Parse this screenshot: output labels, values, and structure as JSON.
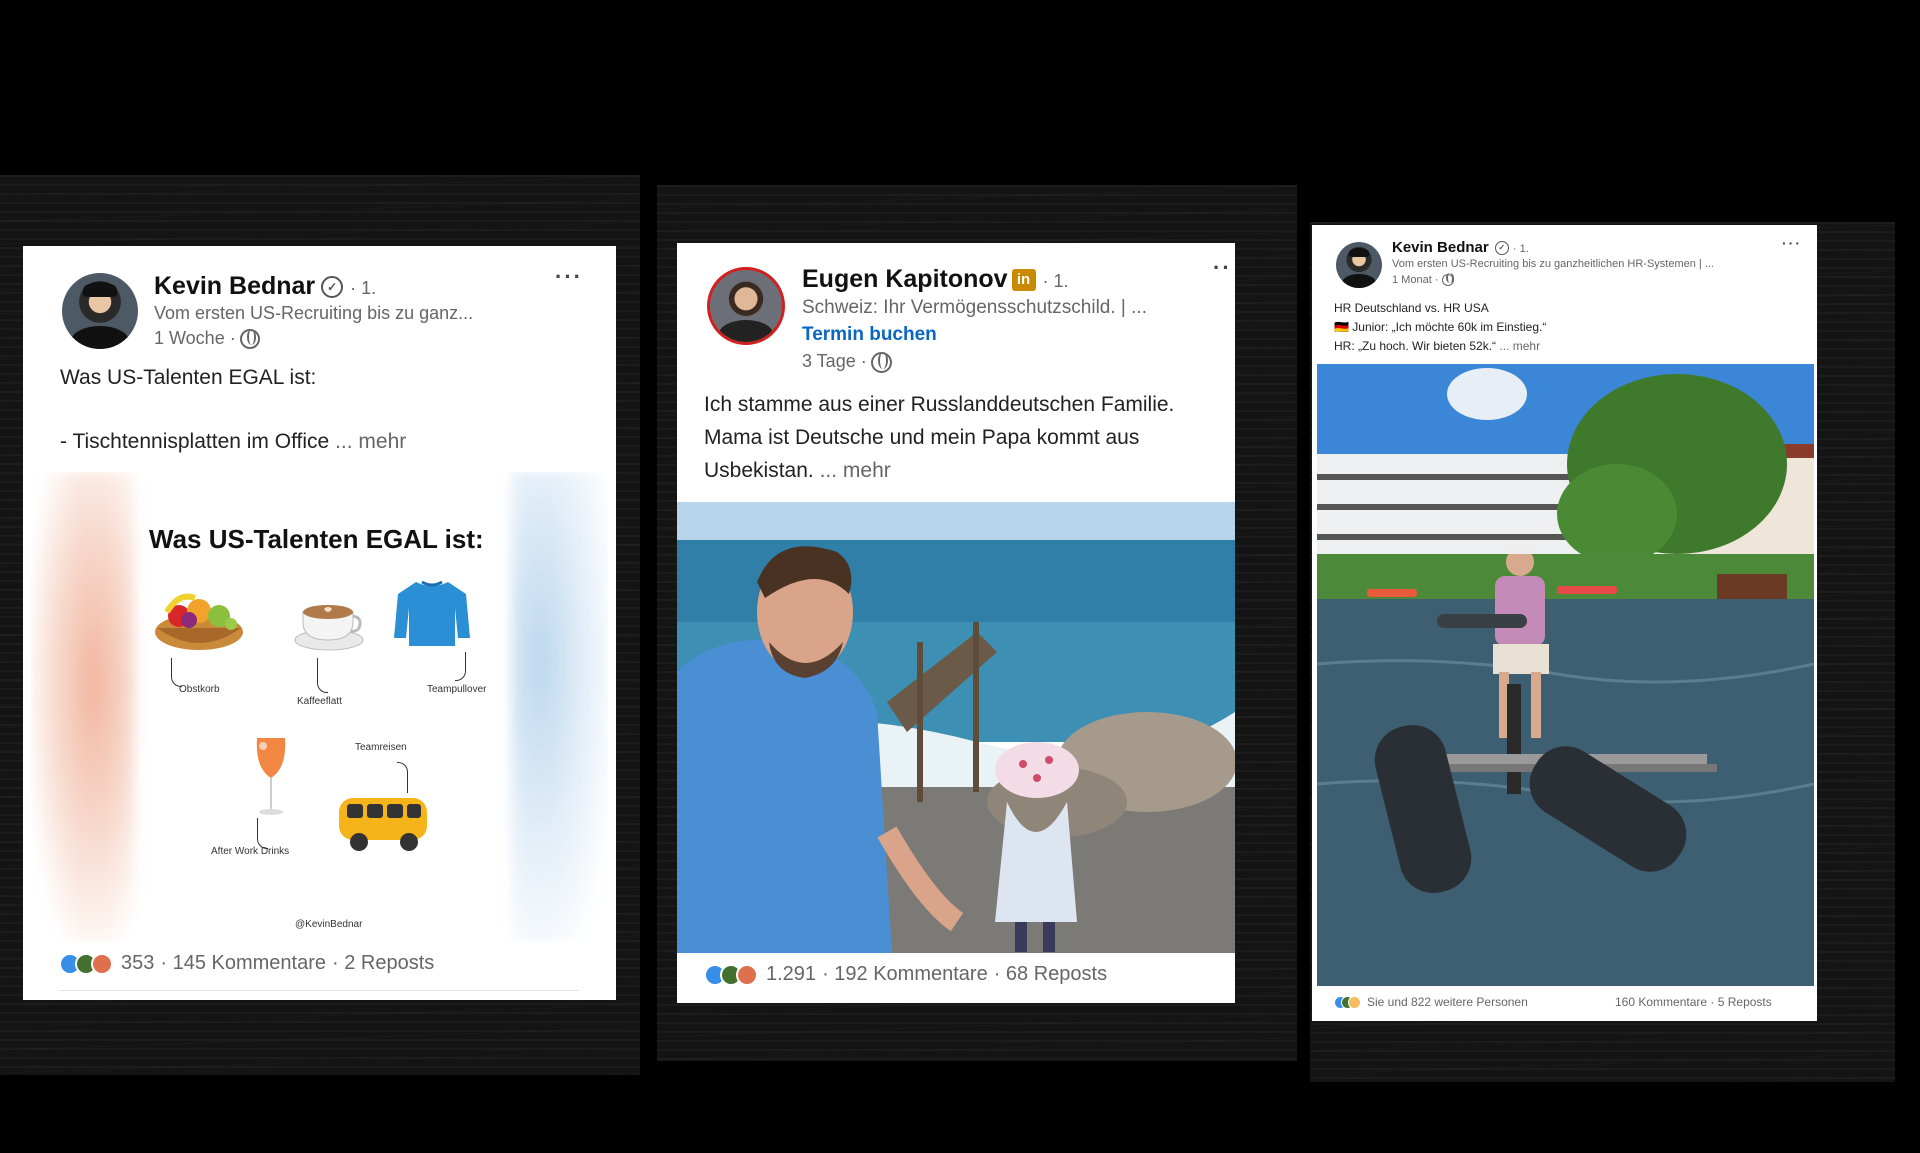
{
  "cards": [
    {
      "author": "Kevin Bednar",
      "degree": "· 1.",
      "headline": "Vom ersten US-Recruiting bis zu ganz...",
      "time": "1 Woche ·",
      "post_line1": "Was US-Talenten EGAL ist:",
      "post_line2": "- Tischtennisplatten im Office",
      "more": "... mehr",
      "infographic": {
        "title": "Was US-Talenten EGAL ist:",
        "items": [
          "Obstkorb",
          "Kaffeeflatt",
          "Teampullover",
          "Teamreisen",
          "After Work Drinks"
        ],
        "handle": "@KevinBednar"
      },
      "reactions_count": "353",
      "comments": "· 145 Kommentare",
      "reposts": "· 2 Reposts"
    },
    {
      "author": "Eugen Kapitonov",
      "degree": "· 1.",
      "badge": "in",
      "headline": "Schweiz: Ihr Vermögensschutzschild. | ...",
      "cta": "Termin buchen",
      "time": "3 Tage ·",
      "post_line1": "Ich stamme aus einer Russlanddeutschen Familie.",
      "post_line2": "Mama ist Deutsche und mein Papa kommt aus",
      "post_line3": "Usbekistan.",
      "more": "... mehr",
      "reactions_count": "1.291",
      "comments": "· 192 Kommentare",
      "reposts": "· 68 Reposts"
    },
    {
      "author": "Kevin Bednar",
      "degree": "· 1.",
      "headline": "Vom ersten US-Recruiting bis zu ganzheitlichen HR-Systemen | ...",
      "time": "1 Monat ·",
      "post_line1": "HR Deutschland vs. HR USA",
      "post_line2": "🇩🇪 Junior: „Ich möchte 60k im Einstieg.“",
      "post_line3": "HR: „Zu hoch. Wir bieten 52k.“",
      "more": "... mehr",
      "reactions_text": "Sie und 822 weitere Personen",
      "comments_reposts": "160 Kommentare · 5 Reposts"
    }
  ],
  "icons": [
    "verified-icon",
    "globe-icon",
    "more-options-icon",
    "linkedin-premium-icon",
    "reaction-like-icon",
    "reaction-celebrate-icon",
    "reaction-love-icon"
  ],
  "colors": {
    "background": "#000000",
    "link": "#0a66c2",
    "like": "#378fe9",
    "premium_badge": "#c98a00"
  }
}
